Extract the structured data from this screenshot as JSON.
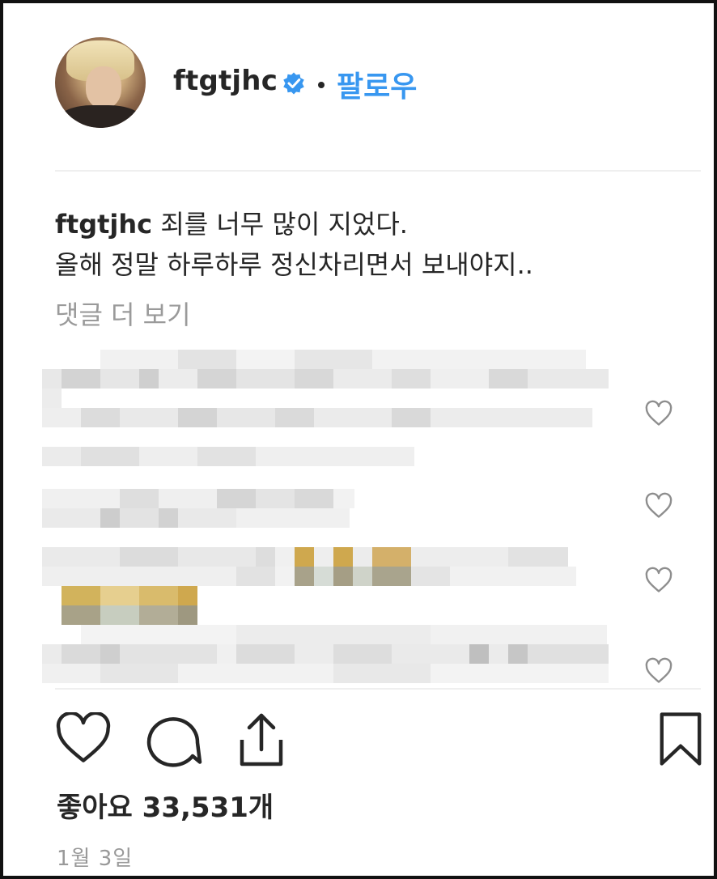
{
  "header": {
    "username": "ftgtjhc",
    "follow_label": "팔로우",
    "separator": "•"
  },
  "caption": {
    "username": "ftgtjhc",
    "line1": "죄를 너무 많이 지었다.",
    "line2": "올해 정말 하루하루 정신차리면서 보내야지.."
  },
  "comments": {
    "view_more": "댓글 더 보기"
  },
  "likes": {
    "text": "좋아요 33,531개"
  },
  "timestamp": "1월 3일",
  "colors": {
    "accent": "#3897f0",
    "text": "#262626",
    "muted": "#999999",
    "border": "#111111"
  },
  "icons": {
    "verified": "verified-badge-icon",
    "like": "heart-icon",
    "comment": "comment-icon",
    "share": "share-icon",
    "save": "bookmark-icon",
    "comment_like": "heart-outline-icon"
  }
}
